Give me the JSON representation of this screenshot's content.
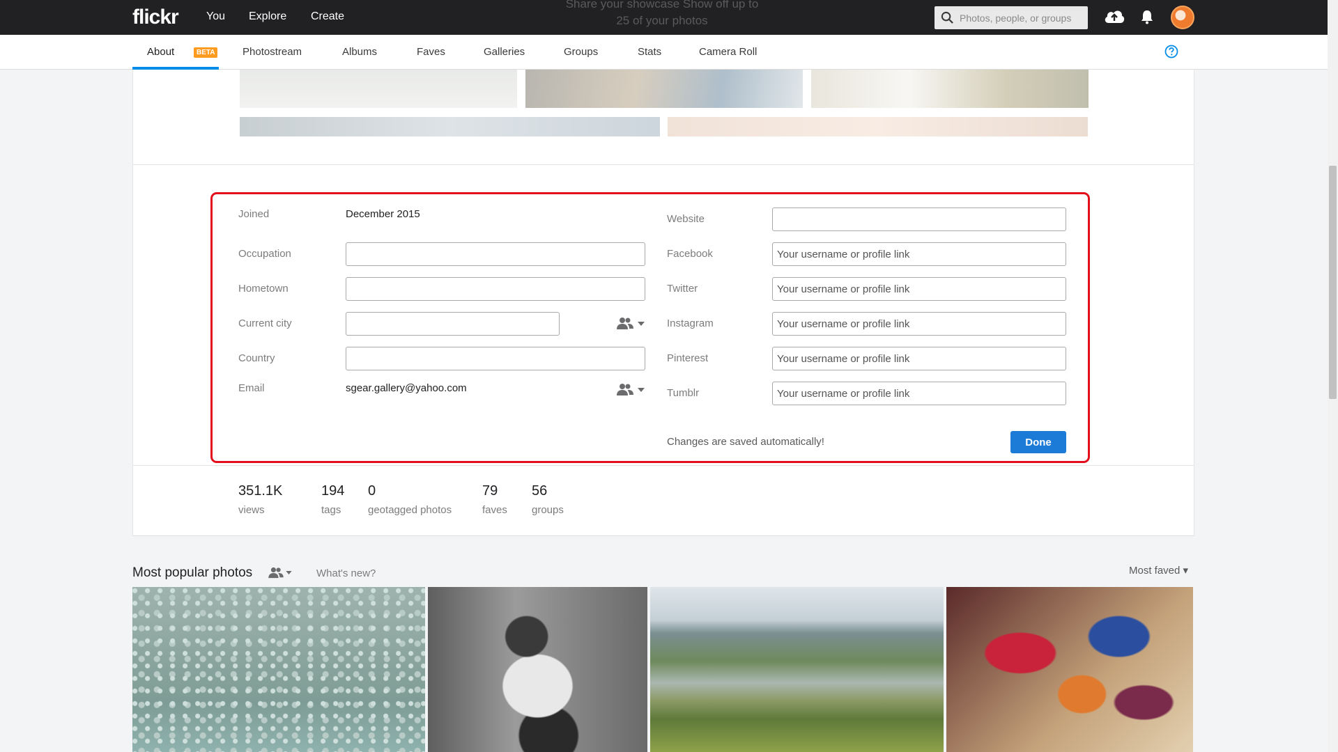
{
  "topnav": {
    "logo": "flickr",
    "links": [
      "You",
      "Explore",
      "Create"
    ],
    "ghost_text": "Share your showcase Show off up to 25 of your photos",
    "search_placeholder": "Photos, people, or groups"
  },
  "subnav": {
    "tabs": [
      "About",
      "Photostream",
      "Albums",
      "Faves",
      "Galleries",
      "Groups",
      "Stats",
      "Camera Roll"
    ],
    "active_tab": "About",
    "badge": "BETA"
  },
  "profile": {
    "joined_label": "Joined",
    "joined_value": "December 2015",
    "occupation_label": "Occupation",
    "hometown_label": "Hometown",
    "current_city_label": "Current city",
    "country_label": "Country",
    "email_label": "Email",
    "email_value": "sgear.gallery@yahoo.com",
    "website_label": "Website",
    "facebook_label": "Facebook",
    "twitter_label": "Twitter",
    "instagram_label": "Instagram",
    "pinterest_label": "Pinterest",
    "tumblr_label": "Tumblr",
    "social_placeholder": "Your username or profile link",
    "saved_note": "Changes are saved automatically!",
    "done_label": "Done"
  },
  "stats": [
    {
      "value": "351.1K",
      "label": "views"
    },
    {
      "value": "194",
      "label": "tags"
    },
    {
      "value": "0",
      "label": "geotagged photos"
    },
    {
      "value": "79",
      "label": "faves"
    },
    {
      "value": "56",
      "label": "groups"
    }
  ],
  "popular": {
    "title": "Most popular photos",
    "whats_new": "What's new?",
    "sort_label": "Most faved"
  },
  "colors": {
    "accent": "#008ce8",
    "highlight_box": "#e30f1c",
    "beta_badge": "#ff9b1e",
    "done_button": "#1b7bd6"
  }
}
